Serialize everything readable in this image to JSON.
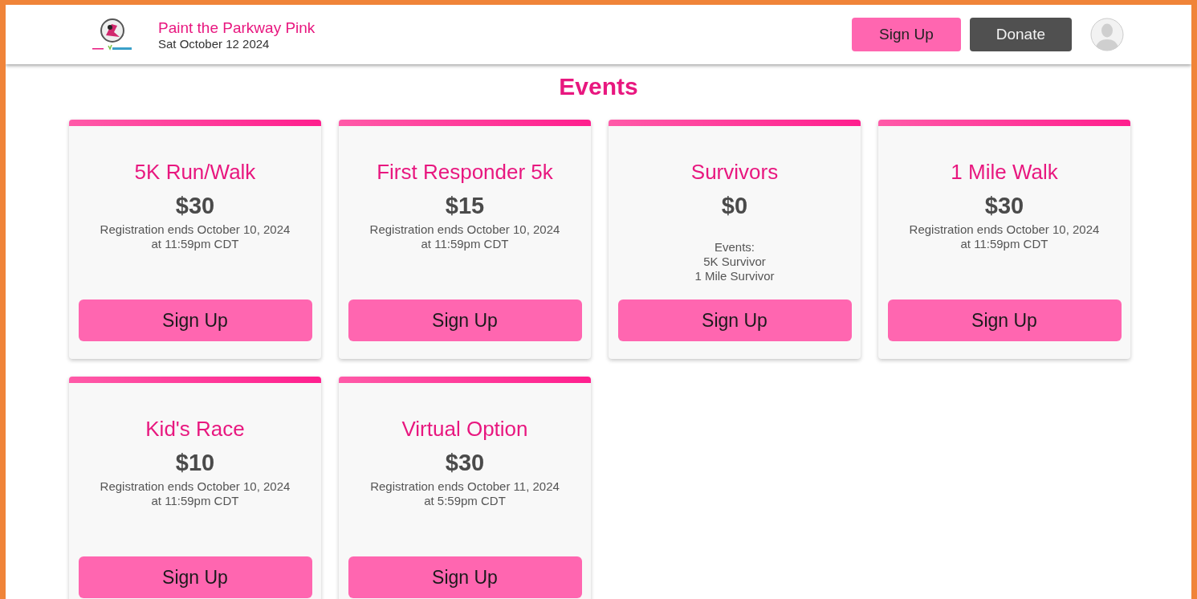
{
  "header": {
    "title": "Paint the Parkway Pink",
    "date": "Sat October 12 2024",
    "buttons": [
      {
        "label": "Sign Up",
        "kind": "primary"
      },
      {
        "label": "Donate",
        "kind": "dark"
      }
    ]
  },
  "heading": "Events",
  "events": [
    {
      "kind": "deadline",
      "title": "5K Run/Walk",
      "price": "$30",
      "lines": [
        "Registration ends October 10, 2024",
        "at 11:59pm CDT"
      ],
      "button": "Sign Up"
    },
    {
      "kind": "deadline",
      "title": "First Responder 5k",
      "price": "$15",
      "lines": [
        "Registration ends October 10, 2024",
        "at 11:59pm CDT"
      ],
      "button": "Sign Up"
    },
    {
      "kind": "events",
      "title": "Survivors",
      "price": "$0",
      "heading": "Events:",
      "lines": [
        "5K Survivor",
        "1 Mile Survivor"
      ],
      "button": "Sign Up"
    },
    {
      "kind": "deadline",
      "title": "1 Mile Walk",
      "price": "$30",
      "lines": [
        "Registration ends October 10, 2024",
        "at 11:59pm CDT"
      ],
      "button": "Sign Up"
    },
    {
      "kind": "deadline",
      "title": "Kid's Race",
      "price": "$10",
      "lines": [
        "Registration ends October 10, 2024",
        "at 11:59pm CDT"
      ],
      "button": "Sign Up"
    },
    {
      "kind": "deadline",
      "title": "Virtual Option",
      "price": "$30",
      "lines": [
        "Registration ends October 11, 2024",
        "at 5:59pm CDT"
      ],
      "button": "Sign Up"
    }
  ]
}
